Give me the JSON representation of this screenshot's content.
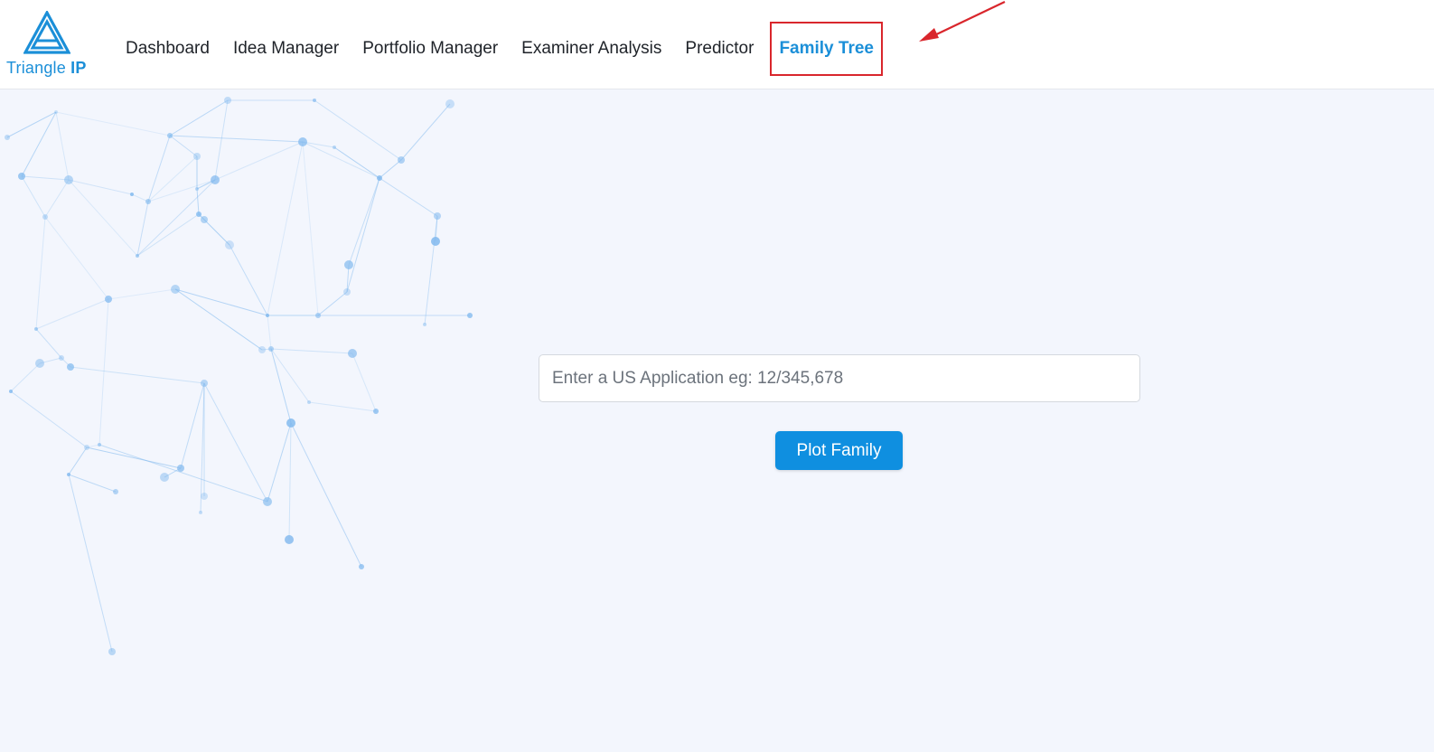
{
  "brand": {
    "name_prefix": "Triangle",
    "name_suffix": "IP",
    "color": "#1b8fd8"
  },
  "nav": {
    "items": [
      {
        "label": "Dashboard"
      },
      {
        "label": "Idea Manager"
      },
      {
        "label": "Portfolio Manager"
      },
      {
        "label": "Examiner Analysis"
      },
      {
        "label": "Predictor"
      },
      {
        "label": "Family Tree",
        "active": true
      }
    ]
  },
  "annotation": {
    "highlight_color": "#d9262c",
    "arrow_icon": "annotation-arrow-icon"
  },
  "search": {
    "value": "",
    "placeholder": "Enter a US Application eg: 12/345,678"
  },
  "plot_button": {
    "label": "Plot Family",
    "color": "#0f8fe0"
  },
  "colors": {
    "background": "#f3f6fd",
    "header": "#ffffff",
    "network": "#7fb8ee"
  }
}
